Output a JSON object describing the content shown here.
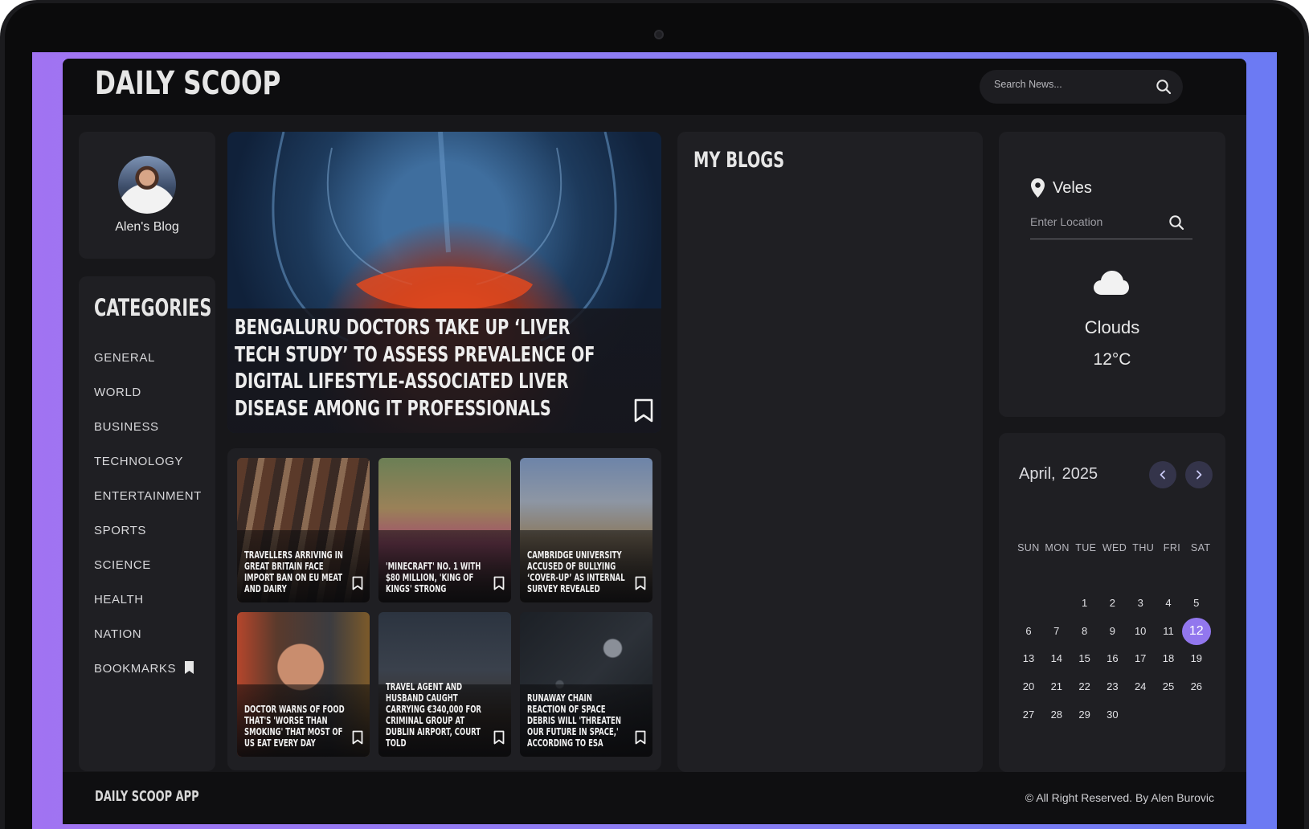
{
  "app": {
    "logo": "DAILY SCOOP"
  },
  "search": {
    "placeholder": "Search News..."
  },
  "profile": {
    "name": "Alen's Blog"
  },
  "categories": {
    "title": "CATEGORIES",
    "items": [
      "GENERAL",
      "WORLD",
      "BUSINESS",
      "TECHNOLOGY",
      "ENTERTAINMENT",
      "SPORTS",
      "SCIENCE",
      "HEALTH",
      "NATION",
      "BOOKMARKS"
    ]
  },
  "featured": {
    "title": "Bengaluru doctors take up ‘Liver Tech Study’ to assess prevalence of digital lifestyle-associated liver disease among IT professionals"
  },
  "news": [
    {
      "title": "Travellers arriving in Great Britain face import ban on EU meat and dairy"
    },
    {
      "title": "'Minecraft' No. 1 with $80 million, 'King of Kings' strong"
    },
    {
      "title": "Cambridge University accused of bullying ‘cover-up’ as internal survey revealed"
    },
    {
      "title": "Doctor warns of food that's 'worse than smoking' that most of us eat every day"
    },
    {
      "title": "Travel agent and husband caught carrying €340,000 for criminal group at Dublin Airport, court told"
    },
    {
      "title": "Runaway chain reaction of space debris will 'threaten our future in space,' according to ESA"
    }
  ],
  "blogs": {
    "title": "MY BLOGS"
  },
  "weather": {
    "location": "Veles",
    "input_placeholder": "Enter Location",
    "condition": "Clouds",
    "temperature": "12°C",
    "icon": "cloud-icon"
  },
  "calendar": {
    "month": "April,",
    "year": "2025",
    "weekdays": [
      "SUN",
      "MON",
      "TUE",
      "WED",
      "THU",
      "FRI",
      "SAT"
    ],
    "first_weekday_index": 2,
    "days_in_month": 30,
    "today": 12
  },
  "footer": {
    "left": "DAILY SCOOP APP",
    "right": "© All Right Reserved. By Alen Burovic"
  },
  "colors": {
    "accent": "#9277ee",
    "panel": "#1f1f23",
    "background": "#17171a"
  }
}
